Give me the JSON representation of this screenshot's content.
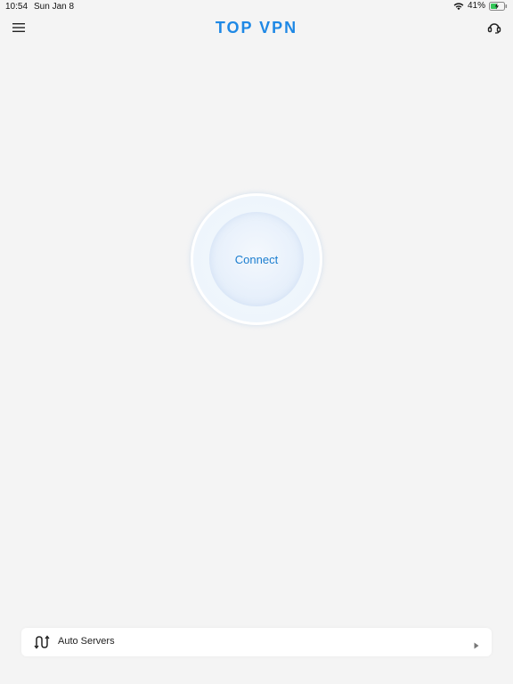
{
  "status_bar": {
    "time": "10:54",
    "date": "Sun Jan 8",
    "battery_percent": "41%",
    "icons": [
      "wifi-icon",
      "battery-charging-icon"
    ]
  },
  "header": {
    "title": "TOP VPN",
    "left_icon": "menu-icon",
    "right_icon": "headset-support-icon"
  },
  "connect": {
    "label": "Connect"
  },
  "server_selector": {
    "label": "Auto Servers",
    "icon": "route-icon",
    "trailing_icon": "play-arrow-icon"
  },
  "colors": {
    "accent": "#1e88e5",
    "connect_text": "#1a7dcf",
    "background": "#f4f4f4",
    "battery_fill": "#34c759"
  }
}
